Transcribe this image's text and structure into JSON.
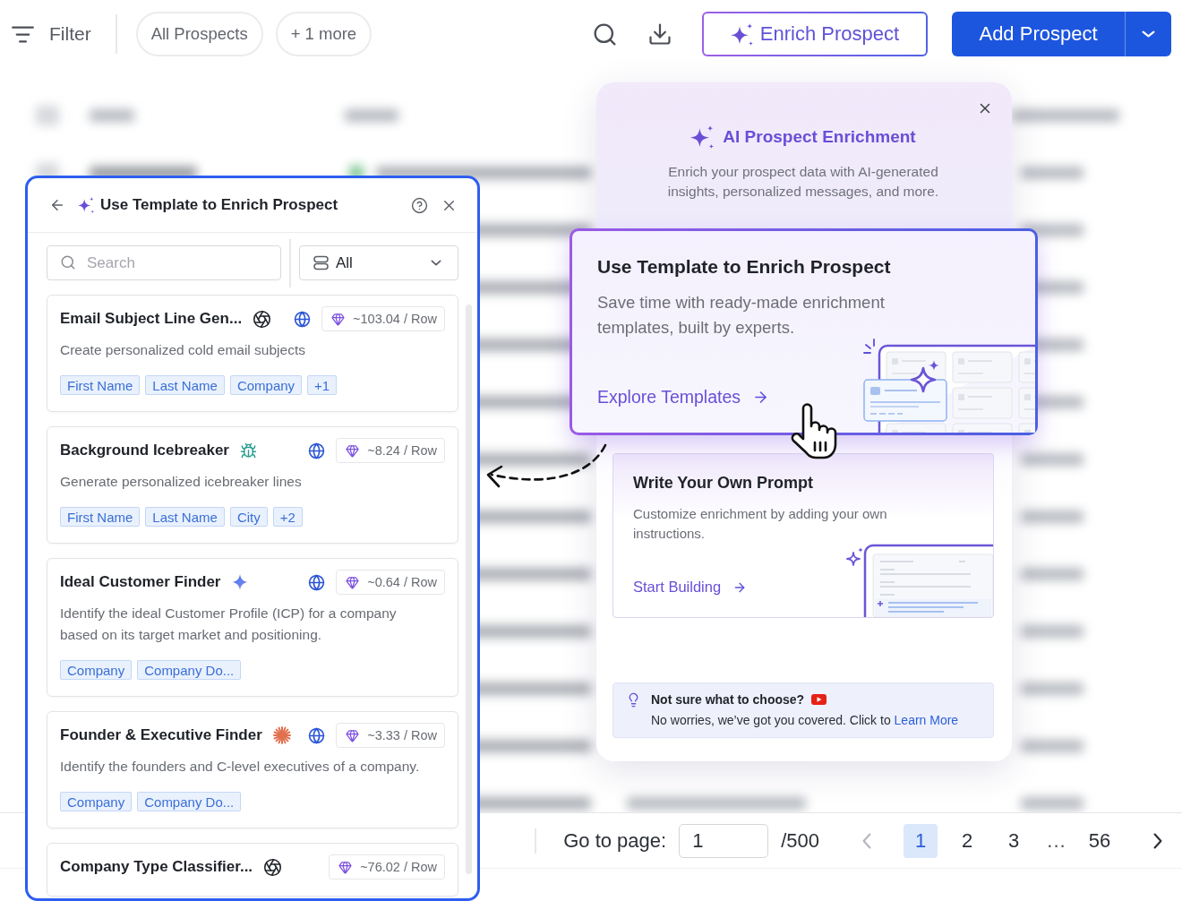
{
  "toolbar": {
    "filter_label": "Filter",
    "chips": [
      "All Prospects",
      "+ 1 more"
    ],
    "enrich_button": "Enrich Prospect",
    "add_button": "Add Prospect"
  },
  "template_panel": {
    "title": "Use Template to Enrich Prospect",
    "search": {
      "placeholder": "Search"
    },
    "category_select": {
      "value": "All"
    },
    "templates": [
      {
        "title": "Email Subject Line Gen...",
        "kind": "knot",
        "web": true,
        "cost": "~103.04 / Row",
        "description": "Create personalized cold email subjects",
        "fields": [
          "First Name",
          "Last Name",
          "Company",
          "+1"
        ]
      },
      {
        "title": "Background Icebreaker",
        "kind": "bug",
        "web": true,
        "cost": "~8.24 / Row",
        "description": "Generate personalized icebreaker lines",
        "fields": [
          "First Name",
          "Last Name",
          "City",
          "+2"
        ]
      },
      {
        "title": "Ideal Customer Finder",
        "kind": "star",
        "web": true,
        "cost": "~0.64 / Row",
        "description": "Identify the ideal Customer Profile (ICP) for a company based on its target market and positioning.",
        "fields": [
          "Company",
          "Company Do..."
        ]
      },
      {
        "title": "Founder & Executive Finder",
        "kind": "burst",
        "web": true,
        "cost": "~3.33 / Row",
        "description": "Identify the founders and C-level executives of a company.",
        "fields": [
          "Company",
          "Company Do..."
        ]
      },
      {
        "title": "Company Type Classifier...",
        "kind": "knot",
        "web": false,
        "cost": "~76.02 / Row"
      }
    ]
  },
  "enrichment_modal": {
    "title": "AI Prospect Enrichment",
    "description": "Enrich your prospect data with AI-generated insights, personalized messages, and more.",
    "options": [
      {
        "kind": "template",
        "title": "Use Template to Enrich Prospect",
        "description": "Save time with ready-made enrichment templates, built by experts.",
        "action": "Explore Templates",
        "selected": true
      },
      {
        "kind": "prompt",
        "title": "Write Your Own Prompt",
        "description": "Customize enrichment by adding your own instructions.",
        "action": "Start Building",
        "selected": false
      }
    ],
    "help": {
      "title": "Not sure what to choose?",
      "text": "No worries, we’ve got you covered. Click to",
      "link": "Learn More"
    }
  },
  "pagination": {
    "label": "Go to page:",
    "value": "1",
    "total": "/500",
    "previous": {
      "disabled": true
    },
    "pages": [
      {
        "kind": "page",
        "label": "1",
        "selected": true
      },
      {
        "kind": "page",
        "label": "2",
        "selected": false
      },
      {
        "kind": "page",
        "label": "3",
        "selected": false
      },
      {
        "kind": "ellipsis",
        "label": "...",
        "selected": false
      },
      {
        "kind": "page",
        "label": "56",
        "selected": false
      }
    ],
    "next": {
      "disabled": false
    }
  }
}
